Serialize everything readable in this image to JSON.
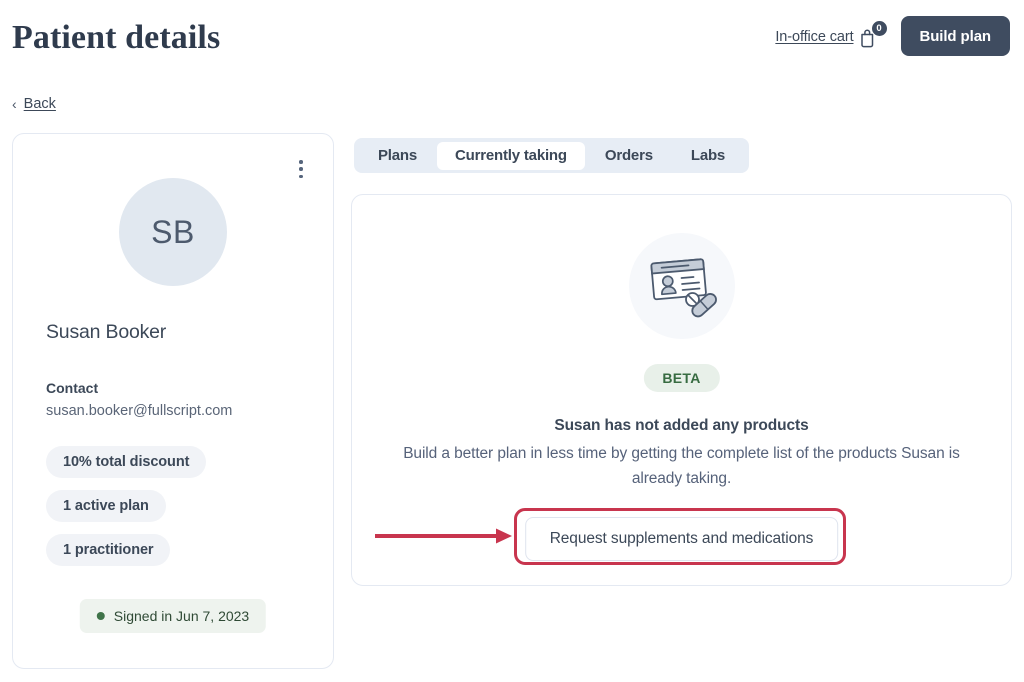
{
  "header": {
    "title": "Patient details",
    "cart_label": "In-office cart",
    "cart_icon": "shopping-bag-icon",
    "cart_count": "0",
    "build_plan_label": "Build plan"
  },
  "back": {
    "chevron": "‹",
    "label": "Back"
  },
  "patient_card": {
    "menu_icon": "kebab-menu-icon",
    "avatar_initials": "SB",
    "name": "Susan Booker",
    "contact_label": "Contact",
    "email": "susan.booker@fullscript.com",
    "chips": [
      "10% total discount",
      "1 active plan",
      "1 practitioner"
    ],
    "signed_status": "Signed in Jun 7, 2023",
    "signed_dot_color": "#3f7349"
  },
  "tabs": [
    {
      "label": "Plans",
      "active": false
    },
    {
      "label": "Currently taking",
      "active": true
    },
    {
      "label": "Orders",
      "active": false
    },
    {
      "label": "Labs",
      "active": false
    }
  ],
  "main": {
    "illustration_icon": "id-card-with-pills-icon",
    "beta_label": "BETA",
    "empty_title": "Susan has not added any products",
    "empty_description": "Build a better plan in less time by getting the complete list of the products Susan is already taking.",
    "request_button_label": "Request supplements and medications"
  },
  "annotation": {
    "highlight_color": "#c8354e",
    "arrow_icon": "right-arrow-annotation",
    "target": "Request supplements and medications"
  },
  "colors": {
    "accent_dark": "#3f4c60",
    "card_border": "#e4e9f2",
    "tab_bar_bg": "#e7edf5",
    "chip_bg": "#f1f3f7",
    "green_badge_bg": "#e8f0e9",
    "green_text": "#376b41",
    "annotation_red": "#c8354e"
  }
}
